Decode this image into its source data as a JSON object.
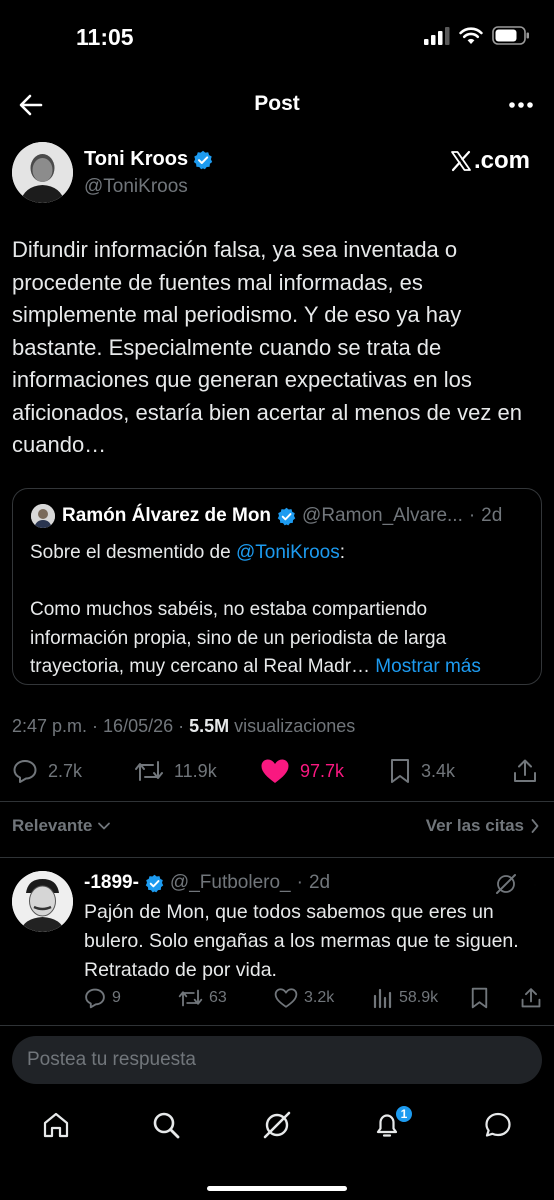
{
  "status_bar": {
    "time": "11:05"
  },
  "header": {
    "title": "Post"
  },
  "author": {
    "name": "Toni Kroos",
    "handle": "@ToniKroos",
    "source_label": "com"
  },
  "post": {
    "text": "Difundir información falsa, ya sea inventada o procedente de fuentes mal informadas, es simplemente mal periodismo. Y de eso ya hay bastante. Especialmente cuando se trata de informaciones que generan expectativas en los aficionados, estaría bien acertar al menos de vez en cuando…",
    "time": "2:47 p.m.",
    "date": "16/05/26",
    "views_count": "5.5M",
    "views_label": "visualizaciones",
    "replies": "2.7k",
    "reposts": "11.9k",
    "likes": "97.7k",
    "bookmarks": "3.4k"
  },
  "quote": {
    "name": "Ramón Álvarez de Mon",
    "handle": "@Ramon_Alvare...",
    "age": "2d",
    "line1_prefix": "Sobre el desmentido de ",
    "line1_mention": "@ToniKroos",
    "line1_suffix": ":",
    "body": "Como muchos sabéis, no estaba compartiendo información propia, sino de un periodista de larga trayectoria, muy cercano al Real Madr…",
    "show_more": "Mostrar más"
  },
  "replies_header": {
    "sort_label": "Relevante",
    "quotes_link": "Ver las citas"
  },
  "reply": {
    "name": "-1899-",
    "handle": "@_Futbolero_",
    "age": "2d",
    "text": "Pajón de Mon, que todos sabemos que eres un bulero. Solo engañas a los mermas que te siguen. Retratado de por vida.",
    "replies": "9",
    "reposts": "63",
    "likes": "3.2k",
    "views": "58.9k"
  },
  "composer": {
    "placeholder": "Postea tu respuesta"
  },
  "nav": {
    "notifications_badge": "1"
  },
  "colors": {
    "background": "#000000",
    "accent": "#1d9bf0",
    "like": "#f91880",
    "muted": "#71767b"
  }
}
